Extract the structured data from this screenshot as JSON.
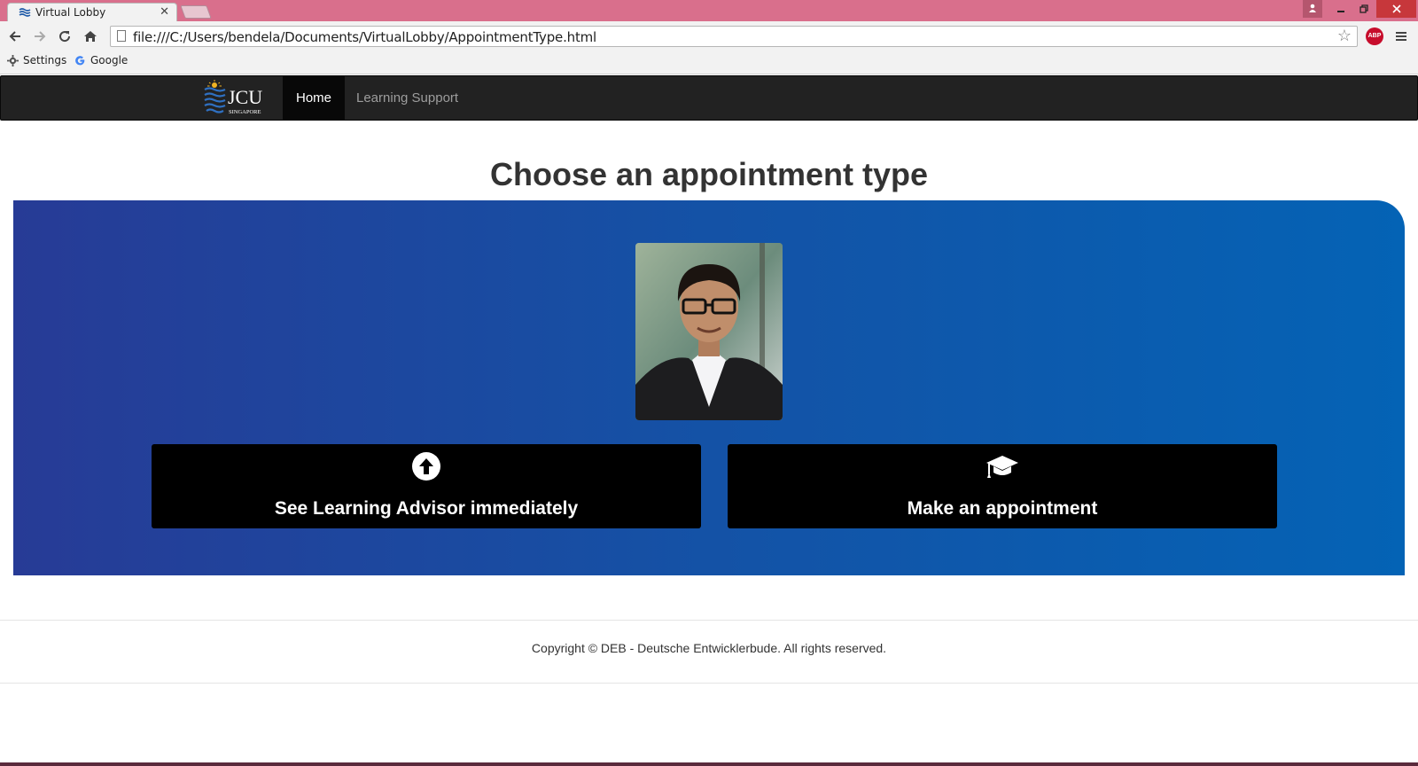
{
  "browser": {
    "tab_title": "Virtual Lobby",
    "tab_close": "✕",
    "url": "file:///C:/Users/bendela/Documents/VirtualLobby/AppointmentType.html",
    "abp_label": "ABP",
    "bookmarks": [
      {
        "label": "Settings",
        "icon": "gear-icon"
      },
      {
        "label": "Google",
        "icon": "google-icon"
      }
    ]
  },
  "navbar": {
    "brand_text": "JCU",
    "brand_sub": "SINGAPORE",
    "items": [
      {
        "label": "Home",
        "active": true
      },
      {
        "label": "Learning Support",
        "active": false
      }
    ]
  },
  "main": {
    "title": "Choose an appointment type",
    "options": [
      {
        "label": "See Learning Advisor immediately",
        "icon": "arrow-up-circle-icon"
      },
      {
        "label": "Make an appointment",
        "icon": "graduation-cap-icon"
      }
    ]
  },
  "footer": {
    "copyright": "Copyright © DEB - Deutsche Entwicklerbude. All rights reserved."
  },
  "colors": {
    "navbar_bg": "#222222",
    "hero_gradient_start": "#273b96",
    "hero_gradient_end": "#0463b5",
    "button_bg": "#000000",
    "tabstrip_bg": "#d96f8c"
  }
}
